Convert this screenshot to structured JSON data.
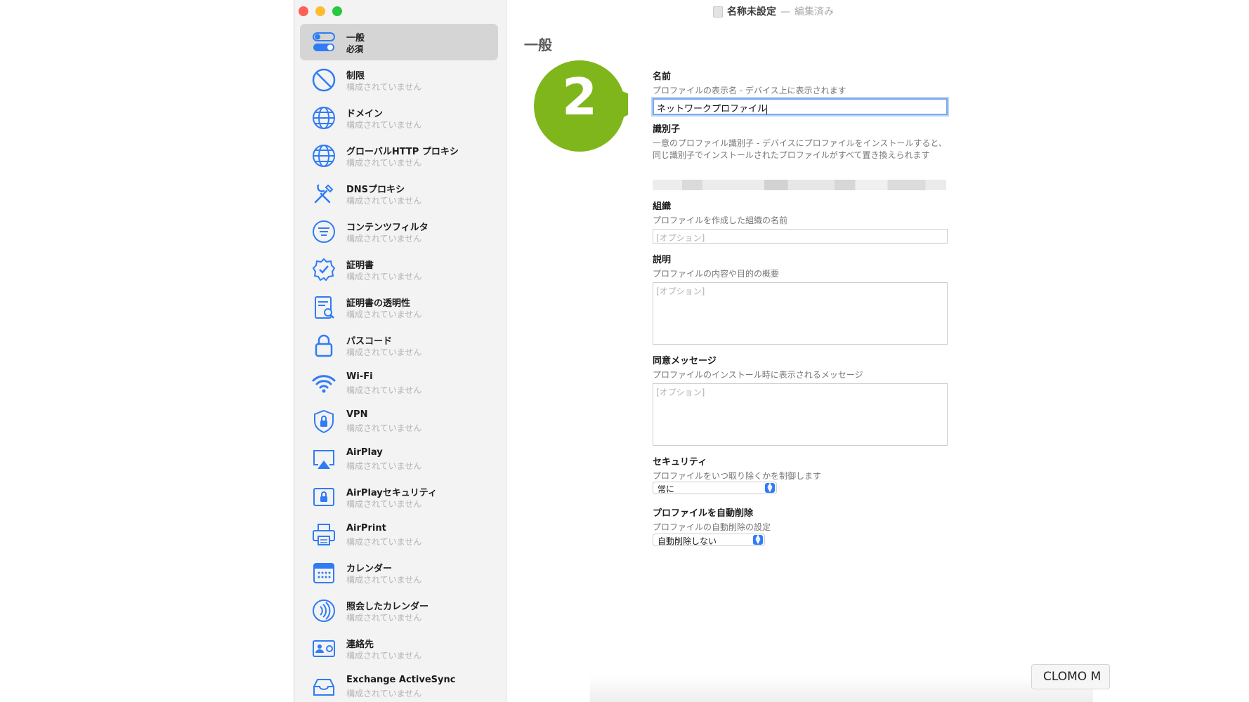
{
  "window": {
    "title": "名称未設定",
    "separator": "—",
    "status": "編集済み"
  },
  "sidebar": {
    "items": [
      {
        "label": "一般",
        "sub": "必須",
        "icon": "toggle-icon",
        "selected": true
      },
      {
        "label": "制限",
        "sub": "構成されていません",
        "icon": "prohibited-icon"
      },
      {
        "label": "ドメイン",
        "sub": "構成されていません",
        "icon": "globe-icon"
      },
      {
        "label": "グローバルHTTP プロキシ",
        "sub": "構成されていません",
        "icon": "globe-icon"
      },
      {
        "label": "DNSプロキシ",
        "sub": "構成されていません",
        "icon": "tools-icon"
      },
      {
        "label": "コンテンツフィルタ",
        "sub": "構成されていません",
        "icon": "filter-icon"
      },
      {
        "label": "証明書",
        "sub": "構成されていません",
        "icon": "certificate-badge-icon"
      },
      {
        "label": "証明書の透明性",
        "sub": "構成されていません",
        "icon": "document-search-icon"
      },
      {
        "label": "パスコード",
        "sub": "構成されていません",
        "icon": "lock-icon"
      },
      {
        "label": "Wi-Fi",
        "sub": "構成されていません",
        "icon": "wifi-icon"
      },
      {
        "label": "VPN",
        "sub": "構成されていません",
        "icon": "shield-lock-icon"
      },
      {
        "label": "AirPlay",
        "sub": "構成されていません",
        "icon": "airplay-icon"
      },
      {
        "label": "AirPlayセキュリティ",
        "sub": "構成されていません",
        "icon": "airplay-lock-icon"
      },
      {
        "label": "AirPrint",
        "sub": "構成されていません",
        "icon": "printer-icon"
      },
      {
        "label": "カレンダー",
        "sub": "構成されていません",
        "icon": "calendar-icon"
      },
      {
        "label": "照会したカレンダー",
        "sub": "構成されていません",
        "icon": "broadcast-icon"
      },
      {
        "label": "連絡先",
        "sub": "構成されていません",
        "icon": "contact-card-icon"
      },
      {
        "label": "Exchange ActiveSync",
        "sub": "構成されていません",
        "icon": "tray-icon"
      }
    ]
  },
  "main": {
    "section_title": "一般",
    "name": {
      "label": "名前",
      "description": "プロファイルの表示名 - デバイス上に表示されます",
      "value": "ネットワークプロファイル"
    },
    "identifier": {
      "label": "識別子",
      "description": "一意のプロファイル識別子 - デバイスにプロファイルをインストールすると、同じ識別子でインストールされたプロファイルがすべて置き換えられます"
    },
    "organization": {
      "label": "組織",
      "description": "プロファイルを作成した組織の名前",
      "placeholder": "[オプション]"
    },
    "description_field": {
      "label": "説明",
      "description": "プロファイルの内容や目的の概要",
      "placeholder": "[オプション]"
    },
    "consent": {
      "label": "同意メッセージ",
      "description": "プロファイルのインストール時に表示されるメッセージ",
      "placeholder": "[オプション]"
    },
    "security": {
      "label": "セキュリティ",
      "description": "プロファイルをいつ取り除くかを制御します",
      "value": "常に"
    },
    "auto_remove": {
      "label": "プロファイルを自動削除",
      "description": "プロファイルの自動削除の設定",
      "value": "自動削除しない"
    }
  },
  "annotation": {
    "step": "2",
    "color": "#7fb61b"
  },
  "tooltip": {
    "text": "CLOMO M"
  },
  "colors": {
    "accent": "#2f7cf6",
    "selected_bg": "#d5d5d5",
    "sidebar_bg": "#f3f3f3"
  }
}
